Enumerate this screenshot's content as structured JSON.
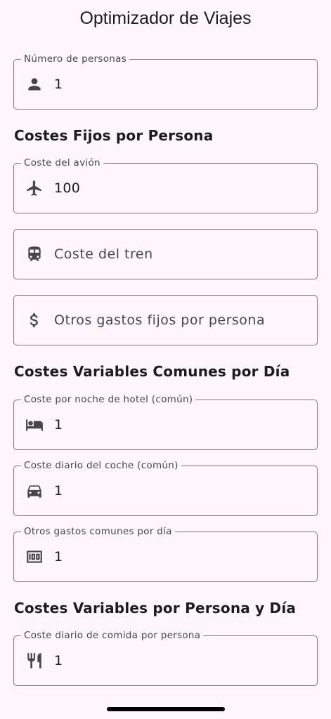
{
  "appbar": {
    "title": "Optimizador de Viajes"
  },
  "sections": {
    "fixed": "Costes Fijos por Persona",
    "common": "Costes Variables Comunes por Día",
    "per_person": "Costes Variables por Persona y Día"
  },
  "fields": {
    "people": {
      "label": "Número de personas",
      "value": "1",
      "icon": "person-icon"
    },
    "plane": {
      "label": "Coste del avión",
      "value": "100",
      "icon": "airplane-icon"
    },
    "train": {
      "placeholder": "Coste del tren",
      "icon": "train-icon"
    },
    "other_fixed": {
      "placeholder": "Otros gastos fijos por persona",
      "icon": "dollar-icon"
    },
    "hotel": {
      "label": "Coste por noche de hotel (común)",
      "value": "1",
      "icon": "hotel-bed-icon"
    },
    "car": {
      "label": "Coste diario del coche (común)",
      "value": "1",
      "icon": "car-icon"
    },
    "other_common": {
      "label": "Otros gastos comunes por día",
      "value": "1",
      "icon": "money-100-icon"
    },
    "food": {
      "label": "Coste diario de comida por persona",
      "value": "1",
      "icon": "restaurant-icon"
    }
  }
}
